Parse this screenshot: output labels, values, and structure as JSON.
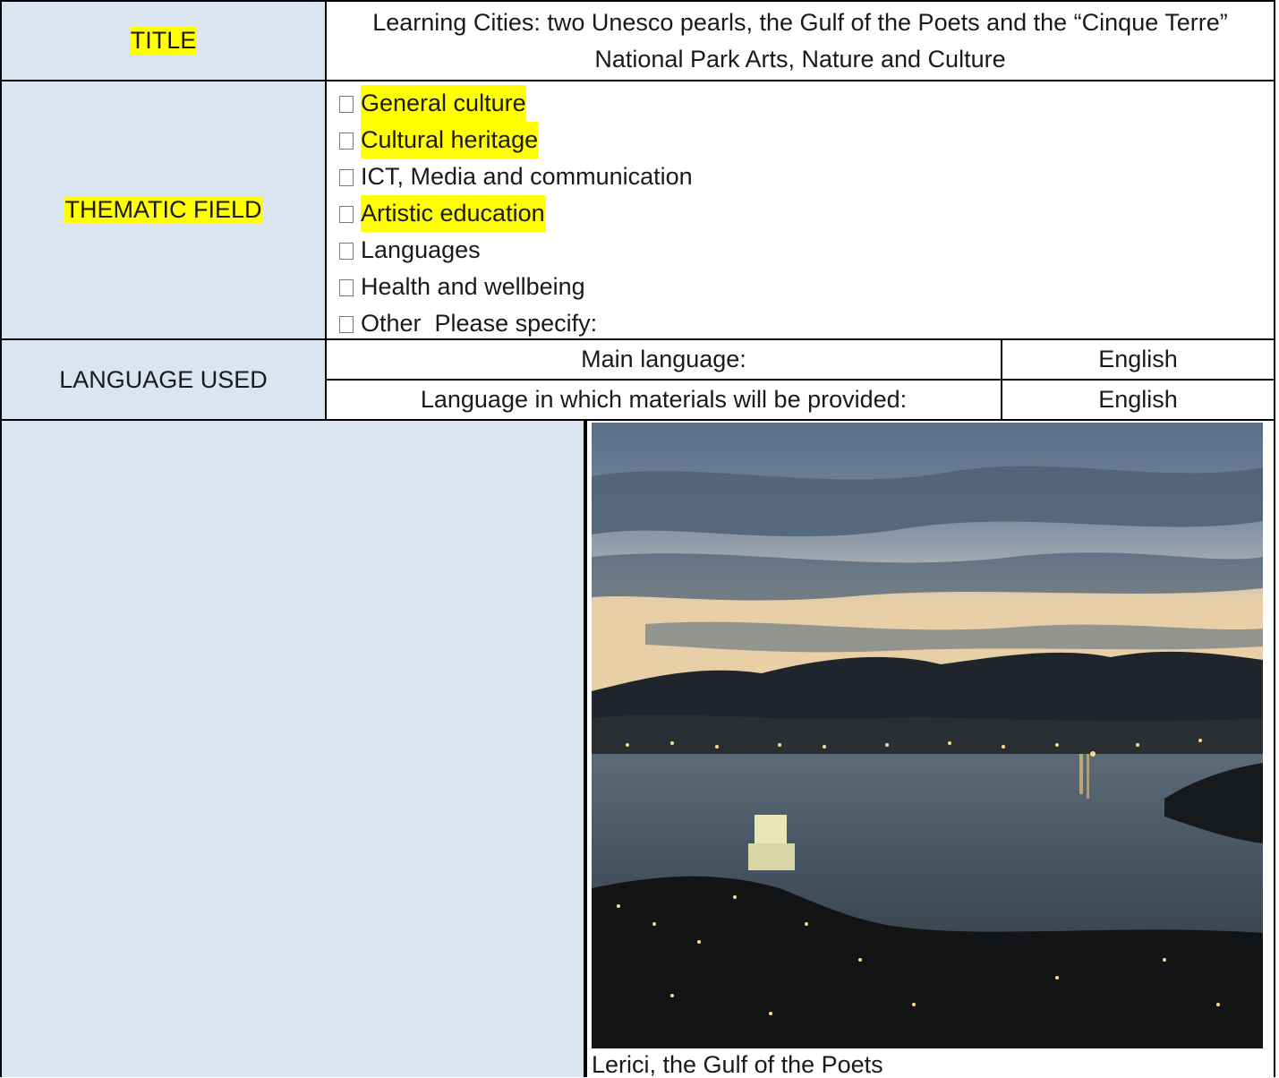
{
  "title_row": {
    "label": "TITLE",
    "value": "Learning Cities: two Unesco pearls, the Gulf of the Poets and the “Cinque Terre” National Park Arts, Nature and Culture"
  },
  "thematic_row": {
    "label": "THEMATIC FIELD",
    "options": [
      {
        "text": "General culture",
        "highlighted": true
      },
      {
        "text": "Cultural heritage",
        "highlighted": true
      },
      {
        "text": "ICT, Media and communication",
        "highlighted": false
      },
      {
        "text": "Artistic education",
        "highlighted": true
      },
      {
        "text": "Languages",
        "highlighted": false
      },
      {
        "text": "Health and wellbeing",
        "highlighted": false
      },
      {
        "text": "Other  Please specify:",
        "highlighted": false
      }
    ]
  },
  "language_row": {
    "label": "LANGUAGE USED",
    "main_label": "Main language:",
    "main_value": "English",
    "materials_label": "Language in which materials will be provided:",
    "materials_value": "English"
  },
  "image_section": {
    "caption": "Lerici, the Gulf of the Poets"
  },
  "colors": {
    "label_shade": "#dbe5f1",
    "highlight": "#ffff00"
  }
}
